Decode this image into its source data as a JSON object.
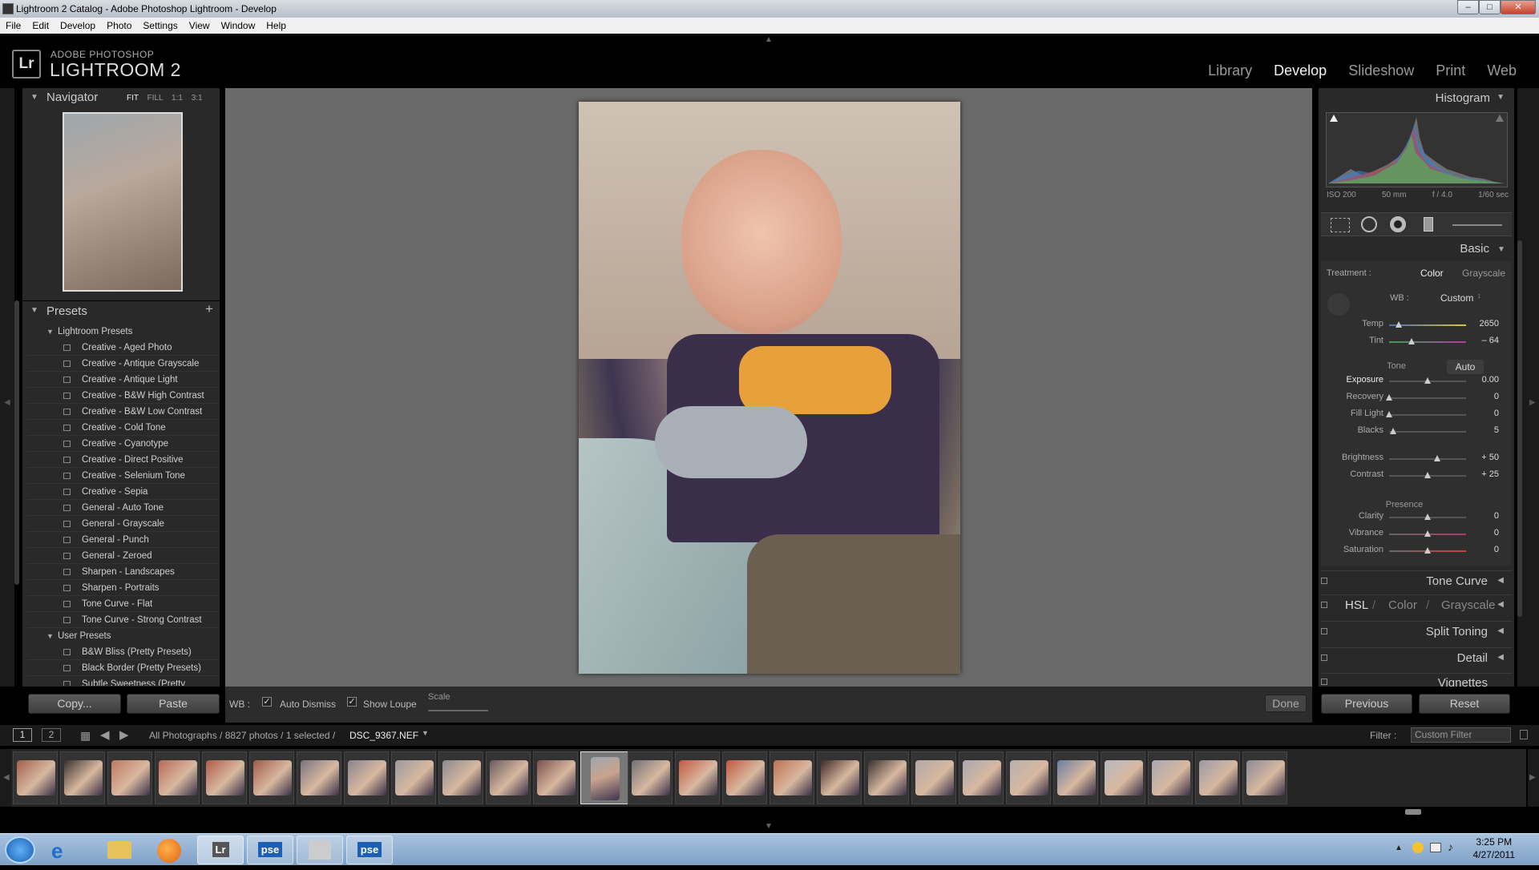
{
  "window": {
    "title": "Lightroom 2 Catalog - Adobe Photoshop Lightroom - Develop"
  },
  "menu": [
    "File",
    "Edit",
    "Develop",
    "Photo",
    "Settings",
    "View",
    "Window",
    "Help"
  ],
  "brand": {
    "line1": "ADOBE PHOTOSHOP",
    "line2": "LIGHTROOM 2",
    "badge": "Lr"
  },
  "modules": [
    "Library",
    "Develop",
    "Slideshow",
    "Print",
    "Web"
  ],
  "navigator": {
    "title": "Navigator",
    "zoom": [
      "FIT",
      "FILL",
      "1:1",
      "3:1"
    ]
  },
  "presets": {
    "title": "Presets",
    "groups": [
      {
        "name": "Lightroom Presets",
        "items": [
          "Creative - Aged Photo",
          "Creative - Antique Grayscale",
          "Creative - Antique Light",
          "Creative - B&W High Contrast",
          "Creative - B&W Low Contrast",
          "Creative - Cold Tone",
          "Creative - Cyanotype",
          "Creative - Direct Positive",
          "Creative - Selenium Tone",
          "Creative - Sepia",
          "General - Auto Tone",
          "General - Grayscale",
          "General - Punch",
          "General - Zeroed",
          "Sharpen - Landscapes",
          "Sharpen - Portraits",
          "Tone Curve - Flat",
          "Tone Curve - Strong Contrast"
        ]
      },
      {
        "name": "User Presets",
        "items": [
          "B&W Bliss (Pretty Presets)",
          "Black Border (Pretty Presets)",
          "Subtle Sweetness (Pretty Presets)"
        ]
      }
    ]
  },
  "leftbuttons": {
    "copy": "Copy...",
    "paste": "Paste"
  },
  "toolbar": {
    "wb": "WB :",
    "auto_dismiss": "Auto Dismiss",
    "show_loupe": "Show Loupe",
    "scale": "Scale",
    "done": "Done"
  },
  "histogram": {
    "title": "Histogram",
    "iso": "ISO 200",
    "focal": "50 mm",
    "aperture": "f / 4.0",
    "shutter": "1/60 sec"
  },
  "basic": {
    "title": "Basic",
    "treatment_label": "Treatment :",
    "color": "Color",
    "grayscale": "Grayscale",
    "wb_label": "WB :",
    "wb_value": "Custom",
    "temp": {
      "label": "Temp",
      "value": "2650",
      "pos": 0.12
    },
    "tint": {
      "label": "Tint",
      "value": "– 64",
      "pos": 0.29
    },
    "tone_label": "Tone",
    "auto": "Auto",
    "exposure": {
      "label": "Exposure",
      "value": "0.00",
      "pos": 0.5
    },
    "recovery": {
      "label": "Recovery",
      "value": "0",
      "pos": 0.0
    },
    "fill_light": {
      "label": "Fill Light",
      "value": "0",
      "pos": 0.0
    },
    "blacks": {
      "label": "Blacks",
      "value": "5",
      "pos": 0.05
    },
    "brightness": {
      "label": "Brightness",
      "value": "+ 50",
      "pos": 0.62
    },
    "contrast": {
      "label": "Contrast",
      "value": "+ 25",
      "pos": 0.5
    },
    "presence_label": "Presence",
    "clarity": {
      "label": "Clarity",
      "value": "0",
      "pos": 0.5
    },
    "vibrance": {
      "label": "Vibrance",
      "value": "0",
      "pos": 0.5
    },
    "saturation": {
      "label": "Saturation",
      "value": "0",
      "pos": 0.5
    }
  },
  "sections": {
    "tone_curve": "Tone Curve",
    "hsl": "HSL",
    "hsl_color": "Color",
    "hsl_gray": "Grayscale",
    "split_toning": "Split Toning",
    "detail": "Detail",
    "vignettes": "Vignettes"
  },
  "rightbuttons": {
    "previous": "Previous",
    "reset": "Reset"
  },
  "filmbar": {
    "screen1": "1",
    "screen2": "2",
    "path": "All Photographs / 8827 photos / 1 selected /",
    "filename": "DSC_9367.NEF",
    "filter_label": "Filter :",
    "filter_value": "Custom Filter"
  },
  "taskbar": {
    "lr": "Lr",
    "pse1": "pse",
    "pse2": "pse",
    "time": "3:25 PM",
    "date": "4/27/2011"
  }
}
